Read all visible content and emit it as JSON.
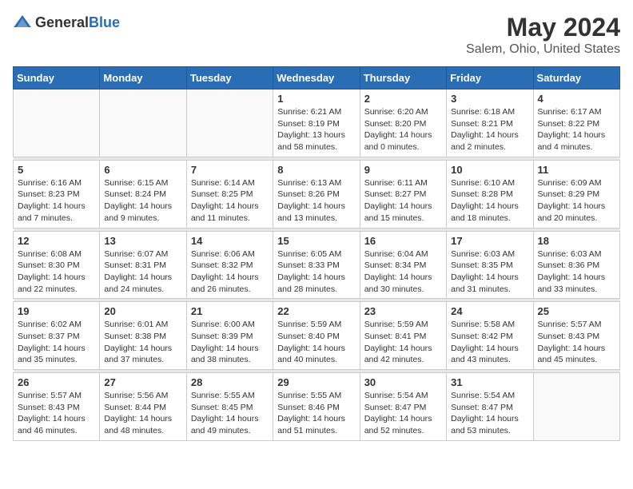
{
  "header": {
    "logo_general": "General",
    "logo_blue": "Blue",
    "month_title": "May 2024",
    "location": "Salem, Ohio, United States"
  },
  "days_of_week": [
    "Sunday",
    "Monday",
    "Tuesday",
    "Wednesday",
    "Thursday",
    "Friday",
    "Saturday"
  ],
  "weeks": [
    [
      {
        "day": "",
        "info": ""
      },
      {
        "day": "",
        "info": ""
      },
      {
        "day": "",
        "info": ""
      },
      {
        "day": "1",
        "info": "Sunrise: 6:21 AM\nSunset: 8:19 PM\nDaylight: 13 hours and 58 minutes."
      },
      {
        "day": "2",
        "info": "Sunrise: 6:20 AM\nSunset: 8:20 PM\nDaylight: 14 hours and 0 minutes."
      },
      {
        "day": "3",
        "info": "Sunrise: 6:18 AM\nSunset: 8:21 PM\nDaylight: 14 hours and 2 minutes."
      },
      {
        "day": "4",
        "info": "Sunrise: 6:17 AM\nSunset: 8:22 PM\nDaylight: 14 hours and 4 minutes."
      }
    ],
    [
      {
        "day": "5",
        "info": "Sunrise: 6:16 AM\nSunset: 8:23 PM\nDaylight: 14 hours and 7 minutes."
      },
      {
        "day": "6",
        "info": "Sunrise: 6:15 AM\nSunset: 8:24 PM\nDaylight: 14 hours and 9 minutes."
      },
      {
        "day": "7",
        "info": "Sunrise: 6:14 AM\nSunset: 8:25 PM\nDaylight: 14 hours and 11 minutes."
      },
      {
        "day": "8",
        "info": "Sunrise: 6:13 AM\nSunset: 8:26 PM\nDaylight: 14 hours and 13 minutes."
      },
      {
        "day": "9",
        "info": "Sunrise: 6:11 AM\nSunset: 8:27 PM\nDaylight: 14 hours and 15 minutes."
      },
      {
        "day": "10",
        "info": "Sunrise: 6:10 AM\nSunset: 8:28 PM\nDaylight: 14 hours and 18 minutes."
      },
      {
        "day": "11",
        "info": "Sunrise: 6:09 AM\nSunset: 8:29 PM\nDaylight: 14 hours and 20 minutes."
      }
    ],
    [
      {
        "day": "12",
        "info": "Sunrise: 6:08 AM\nSunset: 8:30 PM\nDaylight: 14 hours and 22 minutes."
      },
      {
        "day": "13",
        "info": "Sunrise: 6:07 AM\nSunset: 8:31 PM\nDaylight: 14 hours and 24 minutes."
      },
      {
        "day": "14",
        "info": "Sunrise: 6:06 AM\nSunset: 8:32 PM\nDaylight: 14 hours and 26 minutes."
      },
      {
        "day": "15",
        "info": "Sunrise: 6:05 AM\nSunset: 8:33 PM\nDaylight: 14 hours and 28 minutes."
      },
      {
        "day": "16",
        "info": "Sunrise: 6:04 AM\nSunset: 8:34 PM\nDaylight: 14 hours and 30 minutes."
      },
      {
        "day": "17",
        "info": "Sunrise: 6:03 AM\nSunset: 8:35 PM\nDaylight: 14 hours and 31 minutes."
      },
      {
        "day": "18",
        "info": "Sunrise: 6:03 AM\nSunset: 8:36 PM\nDaylight: 14 hours and 33 minutes."
      }
    ],
    [
      {
        "day": "19",
        "info": "Sunrise: 6:02 AM\nSunset: 8:37 PM\nDaylight: 14 hours and 35 minutes."
      },
      {
        "day": "20",
        "info": "Sunrise: 6:01 AM\nSunset: 8:38 PM\nDaylight: 14 hours and 37 minutes."
      },
      {
        "day": "21",
        "info": "Sunrise: 6:00 AM\nSunset: 8:39 PM\nDaylight: 14 hours and 38 minutes."
      },
      {
        "day": "22",
        "info": "Sunrise: 5:59 AM\nSunset: 8:40 PM\nDaylight: 14 hours and 40 minutes."
      },
      {
        "day": "23",
        "info": "Sunrise: 5:59 AM\nSunset: 8:41 PM\nDaylight: 14 hours and 42 minutes."
      },
      {
        "day": "24",
        "info": "Sunrise: 5:58 AM\nSunset: 8:42 PM\nDaylight: 14 hours and 43 minutes."
      },
      {
        "day": "25",
        "info": "Sunrise: 5:57 AM\nSunset: 8:43 PM\nDaylight: 14 hours and 45 minutes."
      }
    ],
    [
      {
        "day": "26",
        "info": "Sunrise: 5:57 AM\nSunset: 8:43 PM\nDaylight: 14 hours and 46 minutes."
      },
      {
        "day": "27",
        "info": "Sunrise: 5:56 AM\nSunset: 8:44 PM\nDaylight: 14 hours and 48 minutes."
      },
      {
        "day": "28",
        "info": "Sunrise: 5:55 AM\nSunset: 8:45 PM\nDaylight: 14 hours and 49 minutes."
      },
      {
        "day": "29",
        "info": "Sunrise: 5:55 AM\nSunset: 8:46 PM\nDaylight: 14 hours and 51 minutes."
      },
      {
        "day": "30",
        "info": "Sunrise: 5:54 AM\nSunset: 8:47 PM\nDaylight: 14 hours and 52 minutes."
      },
      {
        "day": "31",
        "info": "Sunrise: 5:54 AM\nSunset: 8:47 PM\nDaylight: 14 hours and 53 minutes."
      },
      {
        "day": "",
        "info": ""
      }
    ]
  ]
}
